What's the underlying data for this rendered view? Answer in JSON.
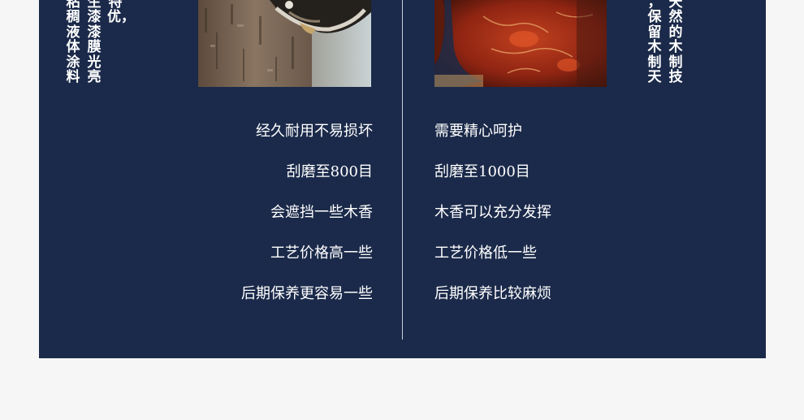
{
  "left_vertical": {
    "col1": "粘稠液体涂料",
    "col2": "生漆漆膜光亮",
    "col3": "特优，"
  },
  "right_vertical": {
    "col1": "，保留木制天",
    "col2": "天然的木制技"
  },
  "photos": {
    "left": "lacquer-tapping-tree-photo",
    "right": "red-wood-carving-photo"
  },
  "left_list": [
    "经久耐用不易损坏",
    "刮磨至800目",
    "会遮挡一些木香",
    "工艺价格高一些",
    "后期保养更容易一些"
  ],
  "right_list": [
    "需要精心呵护",
    "刮磨至1000目",
    "木香可以充分发挥",
    "工艺价格低一些",
    "后期保养比较麻烦"
  ],
  "colors": {
    "panel": "#1b2a4a",
    "page": "#f6f6f6",
    "text": "#ffffff"
  }
}
